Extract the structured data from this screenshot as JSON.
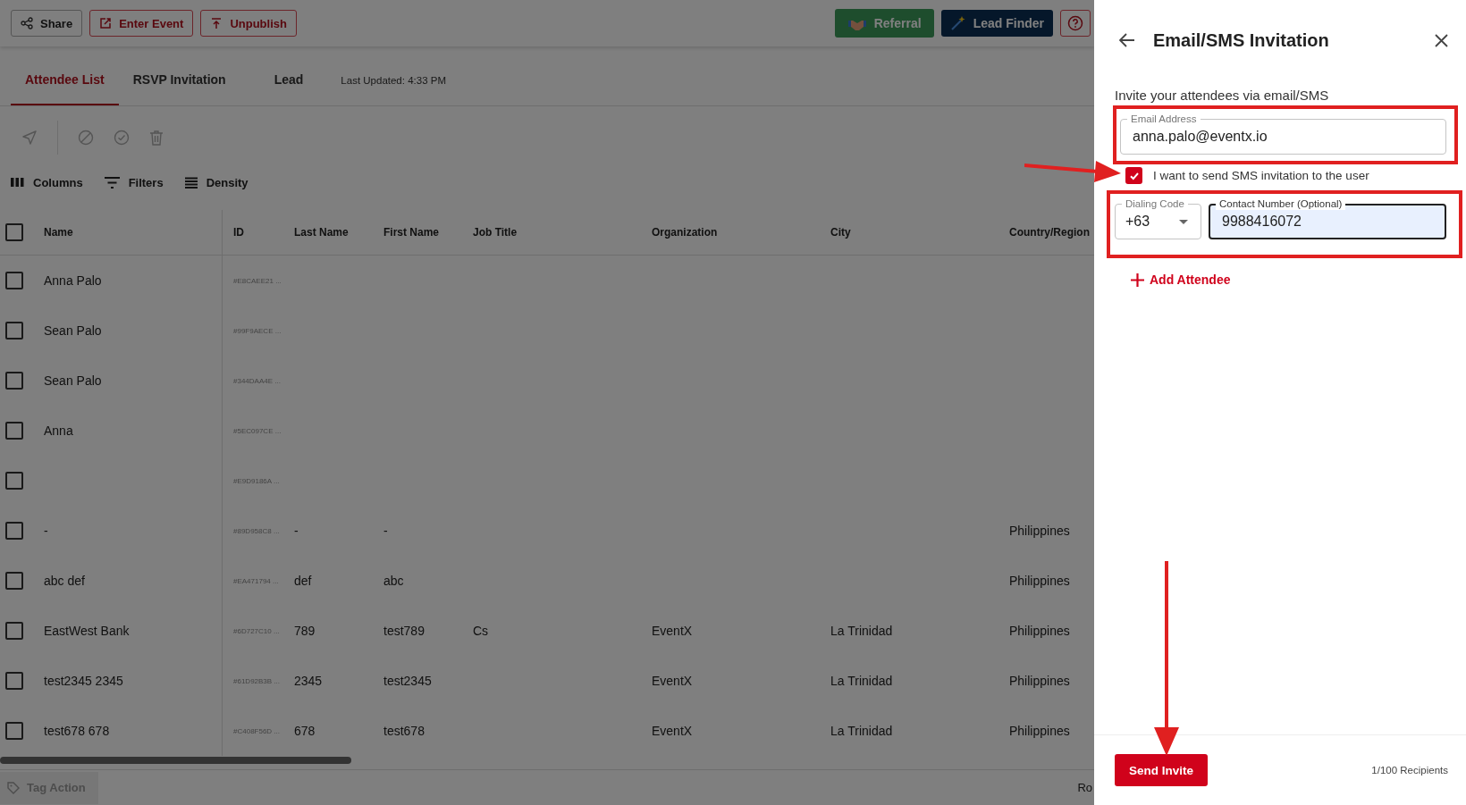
{
  "top_bar": {
    "left_buttons": [
      {
        "label": "Share",
        "kind": "neutral"
      },
      {
        "label": "Enter Event",
        "kind": "enter"
      },
      {
        "label": "Unpublish",
        "kind": "unpublish"
      }
    ],
    "right_buttons": [
      {
        "label": "Referral",
        "kind": "referral"
      },
      {
        "label": "Lead Finder",
        "kind": "finder"
      }
    ]
  },
  "tabs": [
    {
      "label": "Attendee List",
      "selected": true
    },
    {
      "label": "RSVP Invitation",
      "selected": false
    },
    {
      "label": "Lead",
      "selected": false
    }
  ],
  "last_updated": "Last Updated: 4:33 PM",
  "grid_toolbar": [
    {
      "label": "Columns",
      "kind": "columns"
    },
    {
      "label": "Filters",
      "kind": "filters"
    },
    {
      "label": "Density",
      "kind": "density"
    }
  ],
  "table": {
    "columns": [
      "Name",
      "ID",
      "Last Name",
      "First Name",
      "Job Title",
      "Organization",
      "City",
      "Country/Region"
    ],
    "select_all_checked": false,
    "rows": [
      {
        "checked": false,
        "cells": [
          "Anna Palo",
          "#E8CAEE21 ...",
          "",
          "",
          "",
          "",
          "",
          ""
        ]
      },
      {
        "checked": false,
        "cells": [
          "Sean Palo",
          "#99F9AECE ...",
          "",
          "",
          "",
          "",
          "",
          ""
        ]
      },
      {
        "checked": false,
        "cells": [
          "Sean Palo",
          "#344DAA4E ...",
          "",
          "",
          "",
          "",
          "",
          ""
        ]
      },
      {
        "checked": false,
        "cells": [
          "Anna",
          "#5EC097CE ...",
          "",
          "",
          "",
          "",
          "",
          ""
        ]
      },
      {
        "checked": false,
        "cells": [
          "",
          "#E9D9186A ...",
          "",
          "",
          "",
          "",
          "",
          ""
        ]
      },
      {
        "checked": false,
        "cells": [
          "-",
          "#89D958C8 ...",
          "-",
          "-",
          "",
          "",
          "",
          "Philippines"
        ]
      },
      {
        "checked": false,
        "cells": [
          "abc def",
          "#EA471794 ...",
          "def",
          "abc",
          "",
          "",
          "",
          "Philippines"
        ]
      },
      {
        "checked": false,
        "cells": [
          "EastWest Bank",
          "#6D727C10 ...",
          "789",
          "test789",
          "Cs",
          "EventX",
          "La Trinidad",
          "Philippines"
        ]
      },
      {
        "checked": false,
        "cells": [
          "test2345 2345",
          "#61D92B3B ...",
          "2345",
          "test2345",
          "",
          "EventX",
          "La Trinidad",
          "Philippines"
        ]
      },
      {
        "checked": false,
        "cells": [
          "test678 678",
          "#C408F56D ...",
          "678",
          "test678",
          "",
          "EventX",
          "La Trinidad",
          "Philippines"
        ]
      }
    ]
  },
  "footer": {
    "tag_action": "Tag Action",
    "rows_label": "Ro"
  },
  "panel": {
    "title": "Email/SMS Invitation",
    "subtitle": "Invite your attendees via email/SMS",
    "email": {
      "label": "Email Address",
      "value": "anna.palo@eventx.io"
    },
    "sms": {
      "label": "I want to send SMS invitation to the user",
      "checked": true
    },
    "dialing_code": {
      "label": "Dialing Code",
      "value": "+63"
    },
    "contact": {
      "label": "Contact Number (Optional)",
      "value": "9988416072"
    },
    "add_attendee": "Add Attendee",
    "send_button": "Send Invite",
    "recipients": "1/100 Recipients"
  }
}
